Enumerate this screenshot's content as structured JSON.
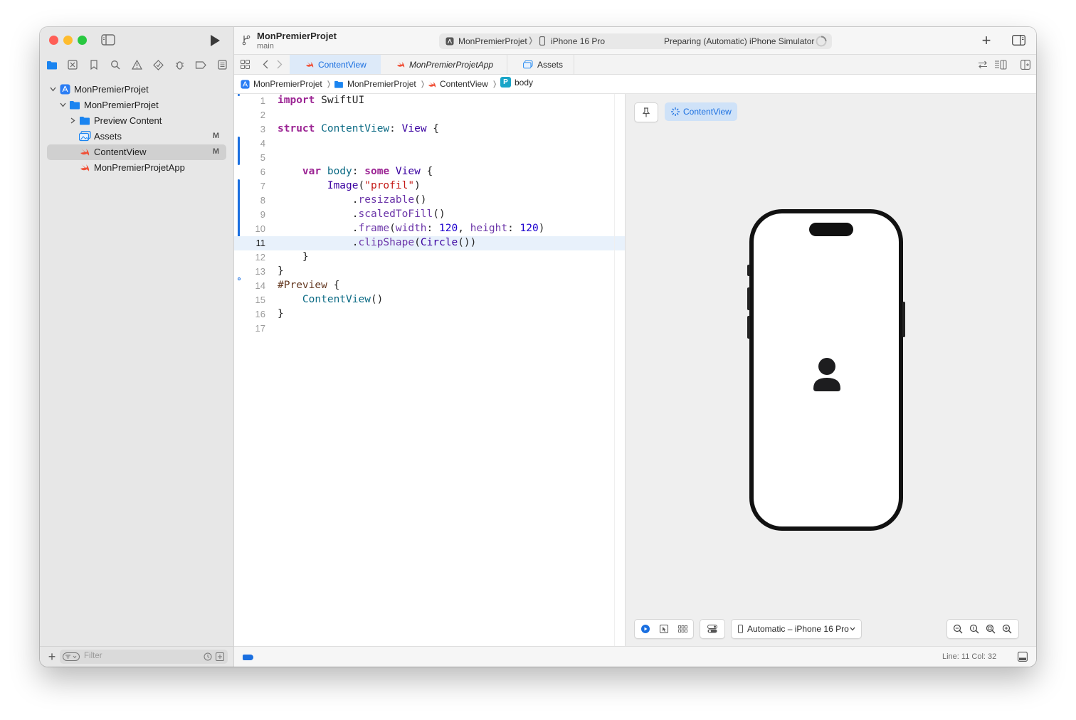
{
  "colors": {
    "accent": "#1a6fe0",
    "swift_orange": "#f05138",
    "folder_blue": "#1a84f0"
  },
  "toolbar": {
    "project_name": "MonPremierProjet",
    "branch": "main",
    "scheme": "MonPremierProjet",
    "destination": "iPhone 16 Pro",
    "activity": "Preparing (Automatic) iPhone Simulator",
    "run_icon": "play-icon",
    "add_icon": "plus-icon"
  },
  "navigator": {
    "items": [
      {
        "label": "MonPremierProjet",
        "icon": "project-icon",
        "badge": ""
      },
      {
        "label": "MonPremierProjet",
        "icon": "folder-icon",
        "badge": ""
      },
      {
        "label": "Preview Content",
        "icon": "folder-icon",
        "badge": ""
      },
      {
        "label": "Assets",
        "icon": "assets-icon",
        "badge": "M"
      },
      {
        "label": "ContentView",
        "icon": "swift-file-icon",
        "badge": "M"
      },
      {
        "label": "MonPremierProjetApp",
        "icon": "swift-file-icon",
        "badge": ""
      }
    ],
    "filter_placeholder": "Filter"
  },
  "tabs": [
    {
      "label": "ContentView",
      "active": true
    },
    {
      "label": "MonPremierProjetApp",
      "active": false
    },
    {
      "label": "Assets",
      "active": false
    }
  ],
  "jumpbar": [
    "MonPremierProjet",
    "MonPremierProjet",
    "ContentView",
    "body"
  ],
  "jumpbar_symbol_badge": "P",
  "code_lines": [
    "import SwiftUI",
    "",
    "struct ContentView: View {",
    "",
    "",
    "    var body: some View {",
    "        Image(\"profil\")",
    "            .resizable()",
    "            .scaledToFill()",
    "            .frame(width: 120, height: 120)",
    "            .clipShape(Circle())",
    "    }",
    "}",
    "#Preview {",
    "    ContentView()",
    "}",
    ""
  ],
  "line_numbers": [
    "1",
    "2",
    "3",
    "4",
    "5",
    "6",
    "7",
    "8",
    "9",
    "10",
    "11",
    "12",
    "13",
    "14",
    "15",
    "16",
    "17"
  ],
  "current_line": 11,
  "preview": {
    "pin_icon": "pin-icon",
    "chip_label": "ContentView",
    "device_menu": "Automatic – iPhone 16 Pro",
    "placeholder_icon": "person-icon"
  },
  "status": {
    "line_col": "Line: 11  Col: 32"
  }
}
